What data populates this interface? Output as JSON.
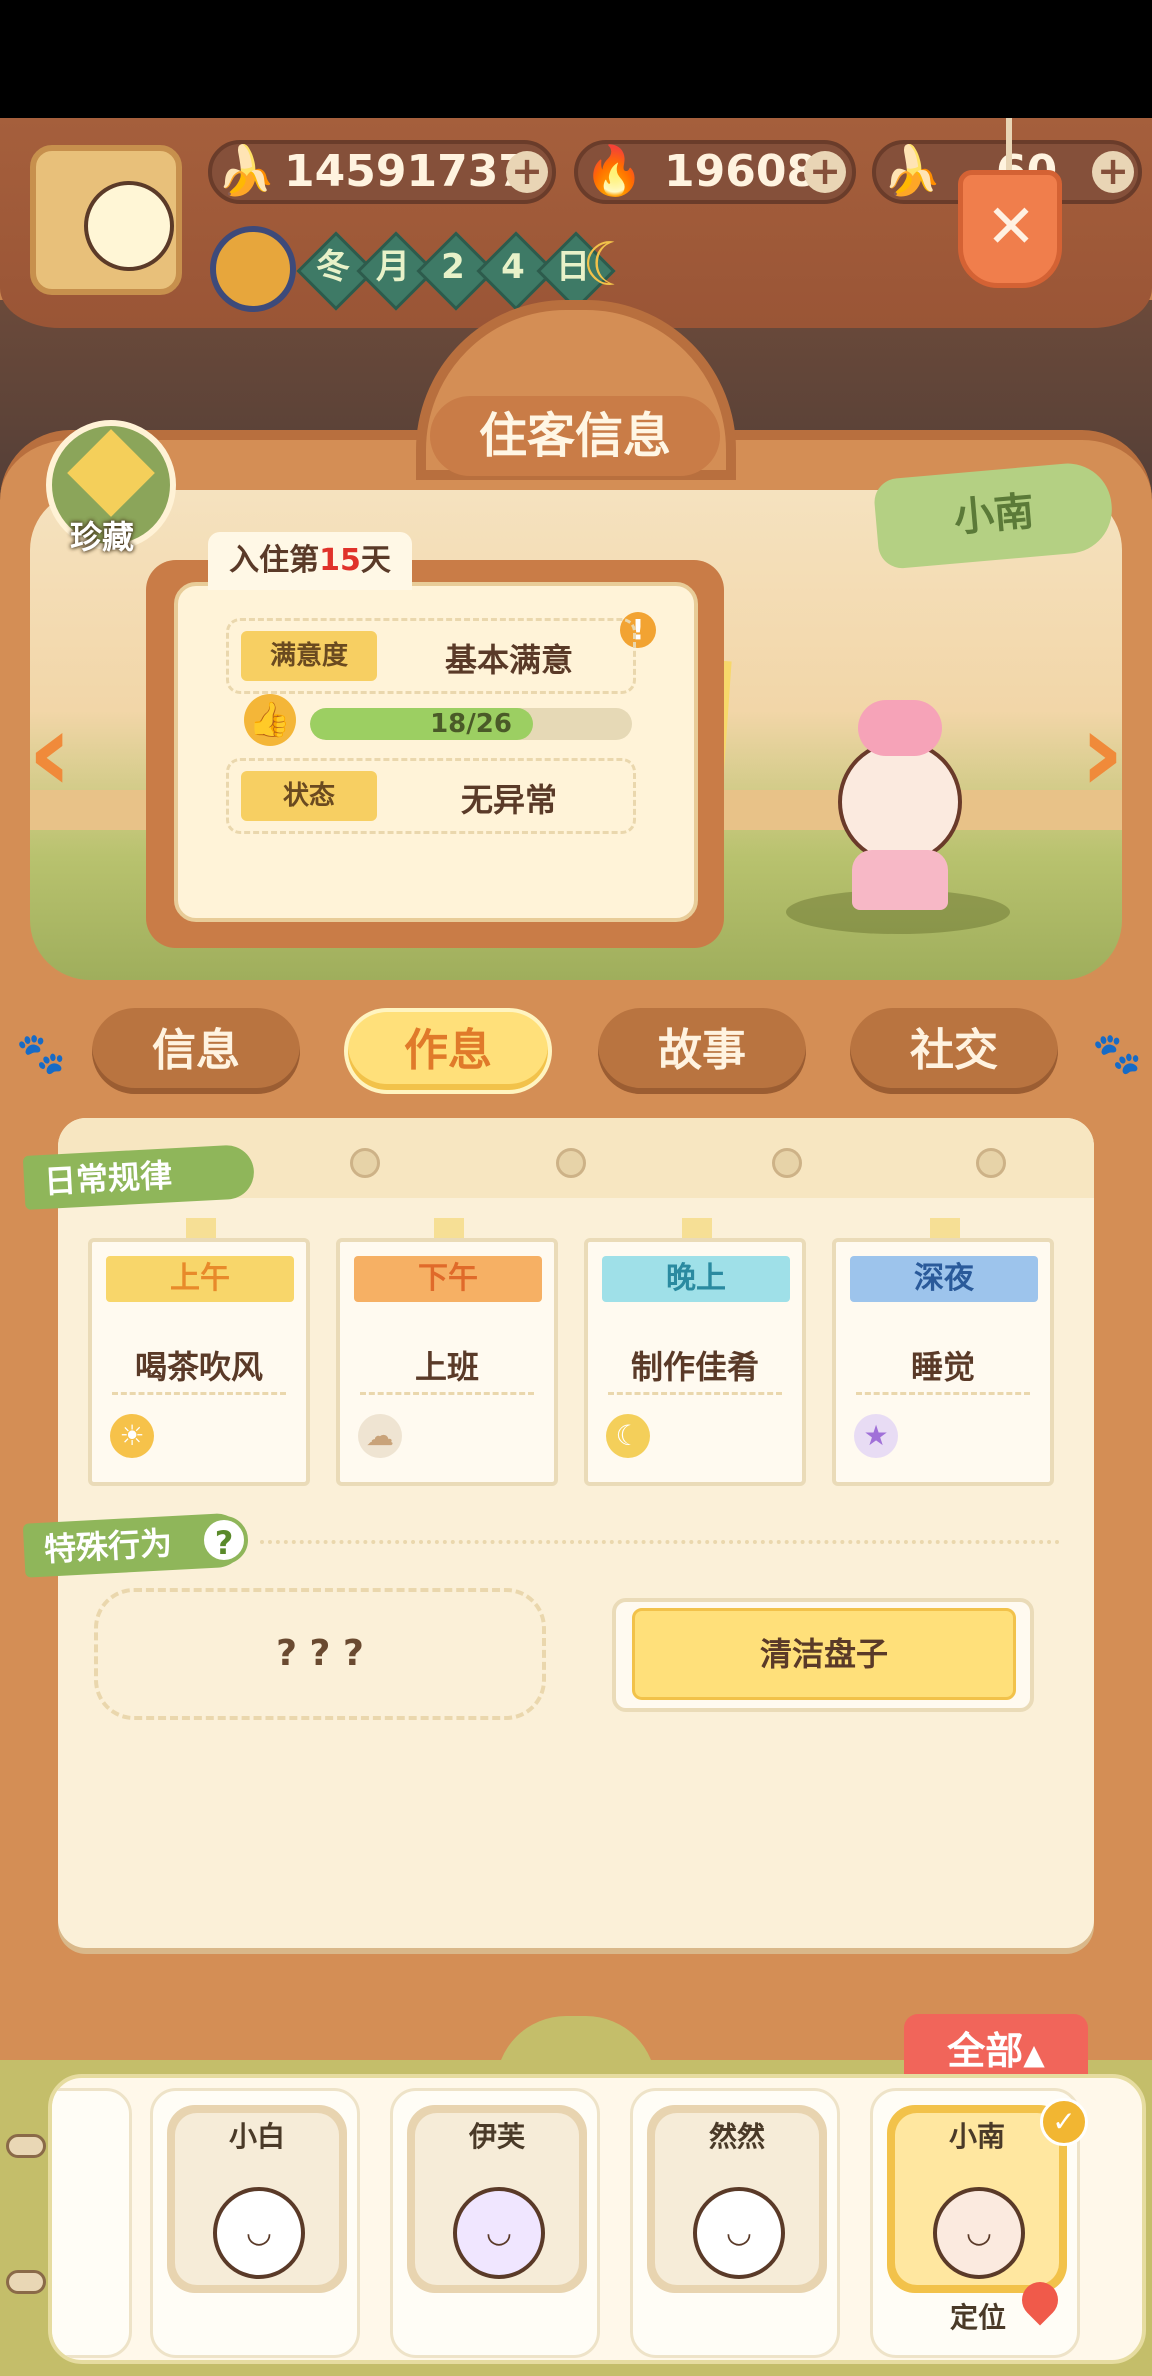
{
  "header": {
    "resources": [
      {
        "name": "banana",
        "icon": "banana-icon",
        "value": "14591737"
      },
      {
        "name": "blue-flame",
        "icon": "blue-flame-icon",
        "value": "19608"
      },
      {
        "name": "blue-banana",
        "icon": "blue-banana-icon",
        "value": "60"
      }
    ],
    "date": {
      "season": "冬",
      "month_label": "月",
      "day_tens": "2",
      "day_ones": "4",
      "day_label": "日"
    },
    "time_icon": "moon-icon"
  },
  "panel": {
    "title": "住客信息",
    "collection_label": "珍藏",
    "resident_name": "小南",
    "stay": {
      "prefix": "入住第",
      "days": "15",
      "suffix": "天"
    },
    "satisfaction": {
      "label": "满意度",
      "value": "基本满意",
      "progress_text": "18/26",
      "progress_fraction": 0.692
    },
    "status": {
      "label": "状态",
      "value": "无异常"
    },
    "warning_icon": "!"
  },
  "tabs": [
    {
      "label": "信息",
      "active": false
    },
    {
      "label": "作息",
      "active": true
    },
    {
      "label": "故事",
      "active": false
    },
    {
      "label": "社交",
      "active": false
    }
  ],
  "routine": {
    "title": "日常规律",
    "slots": [
      {
        "time": "上午",
        "activity": "喝茶吹风",
        "color": "#f8d66a",
        "text_color": "#e88a2a",
        "icon": "sun-icon"
      },
      {
        "time": "下午",
        "activity": "上班",
        "color": "#f6b064",
        "text_color": "#e06a2a",
        "icon": "cloud-icon"
      },
      {
        "time": "晚上",
        "activity": "制作佳肴",
        "color": "#9fe0e8",
        "text_color": "#2a8aa0",
        "icon": "moon-icon"
      },
      {
        "time": "深夜",
        "activity": "睡觉",
        "color": "#9dc4ec",
        "text_color": "#2a5a9a",
        "icon": "star-icon"
      }
    ]
  },
  "special": {
    "title": "特殊行为",
    "help": "?",
    "unknown": "? ? ?",
    "action": "清洁盘子"
  },
  "tray": {
    "filter_label": "全部",
    "filter_arrow": "▲",
    "residents": [
      {
        "name": "小白",
        "face": "◡"
      },
      {
        "name": "伊芙",
        "face": "◡"
      },
      {
        "name": "然然",
        "face": "◡"
      },
      {
        "name": "小南",
        "face": "◡",
        "selected": true
      }
    ],
    "locate_label": "定位",
    "check": "✓"
  },
  "colors": {
    "accent": "#d48e55",
    "selected": "#f2c24a",
    "ribbon": "#8fb65a"
  }
}
